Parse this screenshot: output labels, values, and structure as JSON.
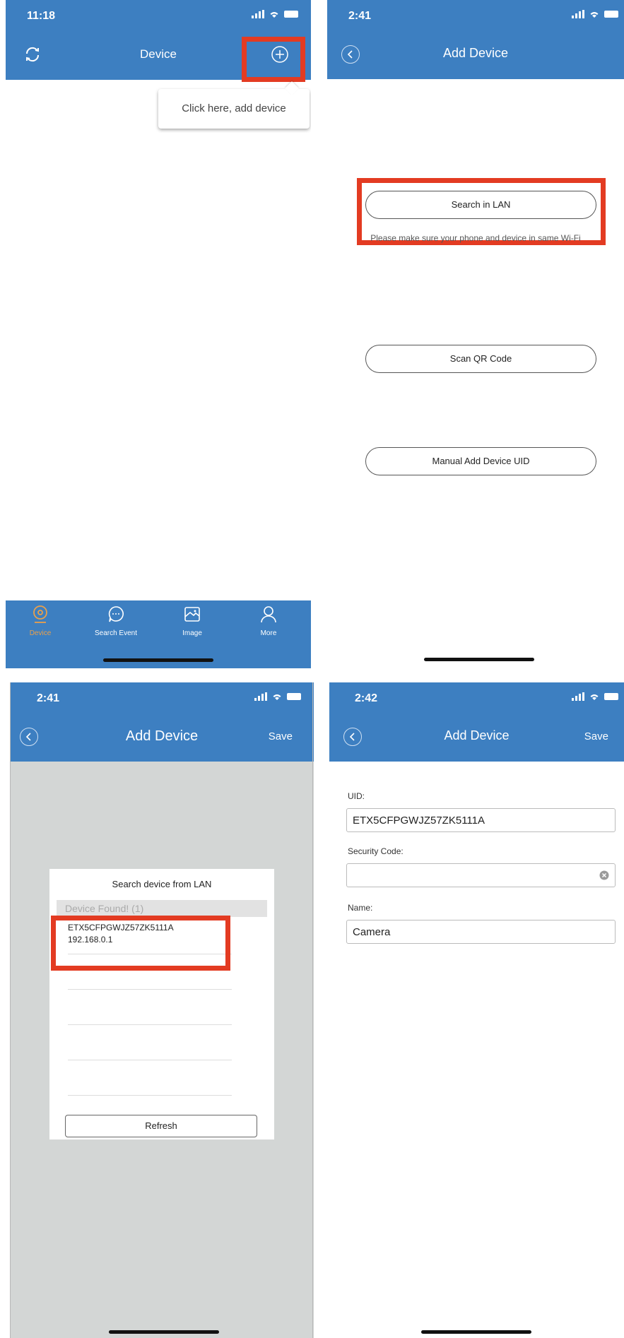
{
  "panel1": {
    "time": "11:18",
    "title": "Device",
    "tooltip": "Click here, add device",
    "tabs": [
      {
        "label": "Device",
        "icon": "webcam-icon"
      },
      {
        "label": "Search Event",
        "icon": "chat-bubble-icon"
      },
      {
        "label": "Image",
        "icon": "image-icon"
      },
      {
        "label": "More",
        "icon": "person-icon"
      }
    ]
  },
  "panel2": {
    "time": "2:41",
    "title": "Add Device",
    "search_lan": "Search in LAN",
    "hint": "Please make sure your phone and device in same Wi-Fi",
    "scan_qr": "Scan QR Code",
    "manual_add": "Manual Add Device UID"
  },
  "panel3": {
    "time": "2:41",
    "title": "Add Device",
    "save": "Save",
    "dialog_title": "Search device from LAN",
    "found_header": "Device Found! (1)",
    "device_uid": "ETX5CFPGWJZ57ZK5111A",
    "device_ip": "192.168.0.1",
    "refresh": "Refresh"
  },
  "panel4": {
    "time": "2:42",
    "title": "Add Device",
    "save": "Save",
    "uid_label": "UID:",
    "uid_value": "ETX5CFPGWJZ57ZK5111A",
    "security_label": "Security Code:",
    "security_value": "",
    "name_label": "Name:",
    "name_value": "Camera"
  },
  "colors": {
    "header_blue": "#3d7fc1",
    "highlight_red": "#e33b22",
    "dialog_backdrop": "#d3d6d5",
    "active_tab": "#e9a04b"
  }
}
